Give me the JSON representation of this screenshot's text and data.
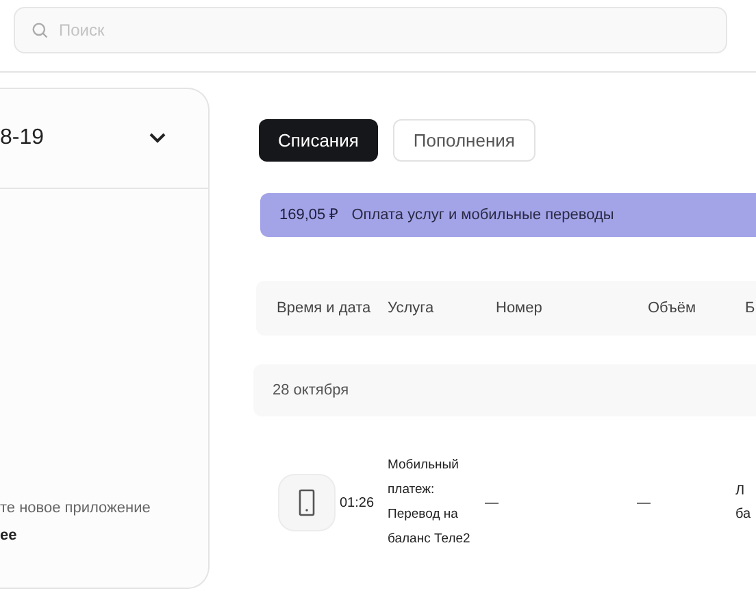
{
  "search": {
    "placeholder": "Поиск"
  },
  "account_card": {
    "title": "8-19",
    "expanded": false,
    "promo_text": "те новое приложение",
    "promo_link": "ее"
  },
  "tabs": [
    {
      "label": "Списания",
      "selected": true
    },
    {
      "label": "Пополнения",
      "selected": false
    }
  ],
  "summary": {
    "amount": "169,05 ₽",
    "label": "Оплата услуг и мобильные переводы"
  },
  "table": {
    "columns": [
      "Время и дата",
      "Услуга",
      "Номер",
      "Объём",
      "Б"
    ],
    "groups": [
      {
        "date": "28 октября",
        "rows": [
          {
            "time": "01:26",
            "service": "Мобильный платеж: Перевод на баланс Теле2",
            "number": "—",
            "volume": "—",
            "column_5": "Л ба"
          }
        ]
      }
    ]
  }
}
